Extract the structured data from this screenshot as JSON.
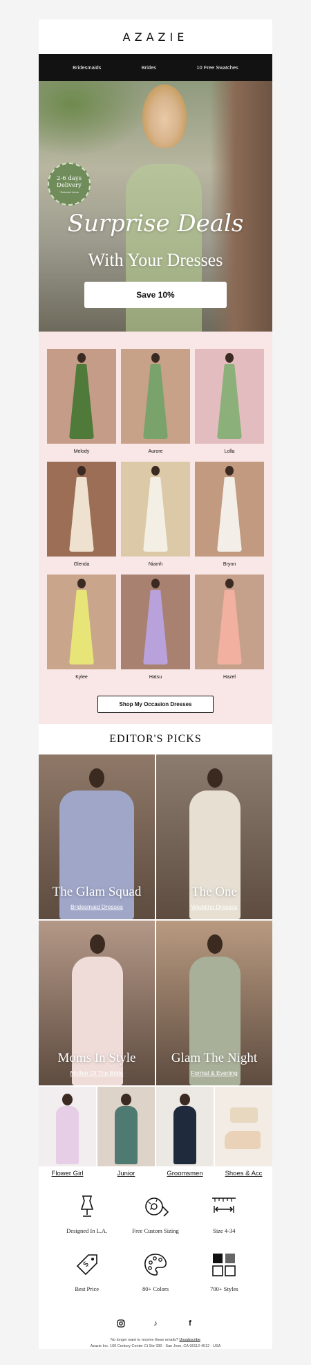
{
  "brand": {
    "logo": "AZAZIE"
  },
  "nav": {
    "items": [
      "Bridesmaids",
      "Brides",
      "10 Free Swatches"
    ]
  },
  "hero": {
    "badge_line1": "2-6 days",
    "badge_line2": "Delivery",
    "badge_line3": "*Selected items",
    "script_title": "Surprise Deals",
    "subtitle": "With Your Dresses",
    "cta": "Save 10%"
  },
  "products": [
    {
      "name": "Melody",
      "bg": "#c59c87",
      "dress": "#4f7a3a"
    },
    {
      "name": "Aurore",
      "bg": "#c8a189",
      "dress": "#7aa26b"
    },
    {
      "name": "Lolla",
      "bg": "#e2bcbe",
      "dress": "#8bb07a"
    },
    {
      "name": "Glenda",
      "bg": "#9c6e55",
      "dress": "#efe1cf"
    },
    {
      "name": "Niamh",
      "bg": "#dcc9a8",
      "dress": "#f4efe5"
    },
    {
      "name": "Brynn",
      "bg": "#c29a80",
      "dress": "#f3efe8"
    },
    {
      "name": "Kylee",
      "bg": "#c9a58c",
      "dress": "#e8e578"
    },
    {
      "name": "Hatsu",
      "bg": "#a88170",
      "dress": "#b9a1dc"
    },
    {
      "name": "Hazel",
      "bg": "#c5a08b",
      "dress": "#f1b0a0"
    }
  ],
  "occasion_cta": "Shop My Occasion Dresses",
  "editors": {
    "heading": "EDITOR'S PICKS",
    "tiles": [
      {
        "title": "The Glam Squad",
        "link": "Bridesmaid Dresses",
        "bg": "#8f7868",
        "dress": "#9fa6c8"
      },
      {
        "title": "The One",
        "link": "Wedding Dresses",
        "bg": "#8c7c70",
        "dress": "#e6dfd2"
      },
      {
        "title": "Moms In Style",
        "link": "Mother Of The Bride",
        "bg": "#b49888",
        "dress": "#efdcd8"
      },
      {
        "title": "Glam The Night",
        "link": "Formal & Evening",
        "bg": "#b89a80",
        "dress": "#a8b09a"
      }
    ]
  },
  "categories": [
    {
      "label": "Flower Girl",
      "bg": "#f2eef0",
      "dress": "#e6cfe6"
    },
    {
      "label": "Junior",
      "bg": "#ddd3c8",
      "dress": "#4f7a72"
    },
    {
      "label": "Groomsmen",
      "bg": "#ece9e4",
      "dress": "#1f2a3c"
    },
    {
      "label": "Shoes & Acc",
      "bg": "#f2ece4",
      "dress": "#e8d8c0"
    }
  ],
  "features": [
    {
      "label": "Designed In L.A.",
      "icon": "dress-form-icon"
    },
    {
      "label": "Free Custom Sizing",
      "icon": "measuring-tape-icon"
    },
    {
      "label": "Size 4-34",
      "icon": "ruler-icon"
    },
    {
      "label": "Best Price",
      "icon": "price-tag-icon"
    },
    {
      "label": "80+ Colors",
      "icon": "palette-icon"
    },
    {
      "label": "700+ Styles",
      "icon": "grid-icon"
    }
  ],
  "footer": {
    "unsubscribe_text": "No longer want to receive these emails?",
    "unsubscribe_link": "Unsubscribe",
    "address": "Azazie Inc. 100 Century Center Ct Ste 330 · San Jose, CA 95112-4512 · USA",
    "social": [
      "instagram-icon",
      "tiktok-icon",
      "facebook-icon"
    ]
  }
}
